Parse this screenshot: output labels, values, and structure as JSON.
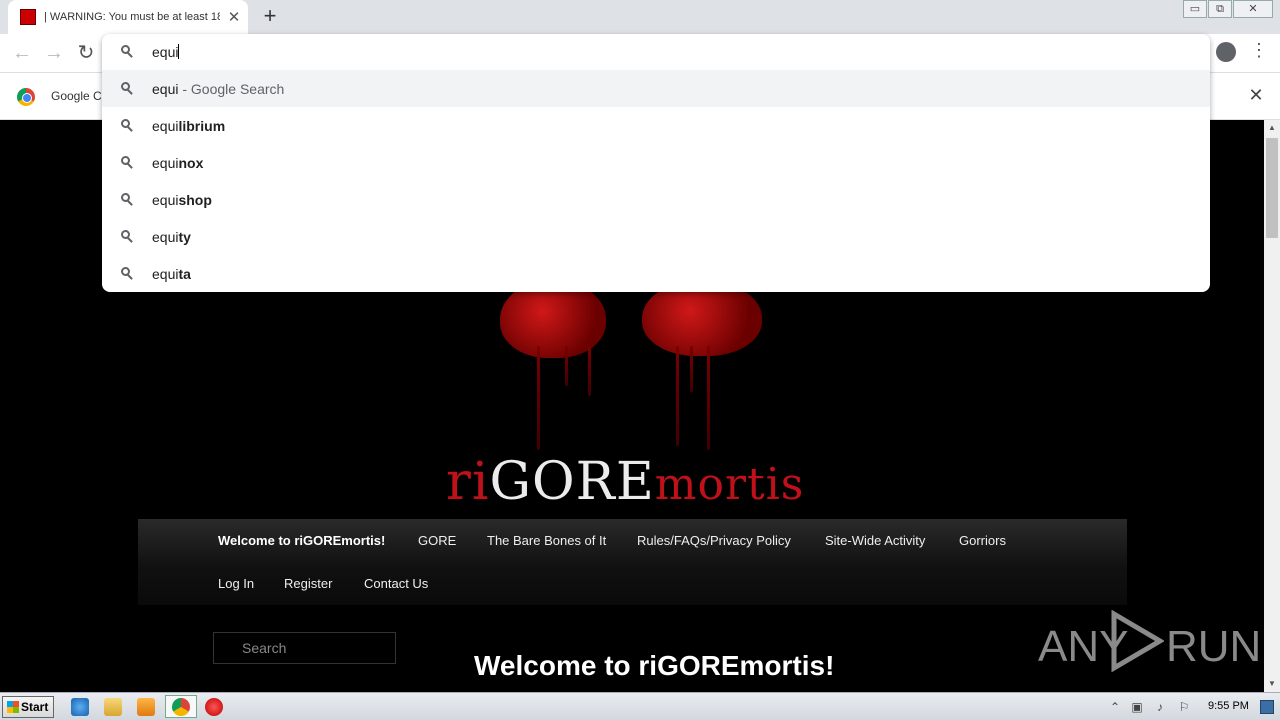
{
  "browser": {
    "tab_title": "| WARNING: You must be at least 18",
    "tab_close_glyph": "✕",
    "new_tab_glyph": "+",
    "window_buttons": [
      "▭",
      "⧉",
      "✕"
    ],
    "nav_glyphs": {
      "back": "←",
      "forward": "→",
      "reload": "↻"
    },
    "menu_glyph": "⋮"
  },
  "omnibox": {
    "value": "equi",
    "suggestions": [
      {
        "typed": "equi",
        "completion": "",
        "suffix": " - Google Search",
        "selected": true
      },
      {
        "typed": "equi",
        "completion": "librium",
        "suffix": "",
        "selected": false
      },
      {
        "typed": "equi",
        "completion": "nox",
        "suffix": "",
        "selected": false
      },
      {
        "typed": "equi",
        "completion": "shop",
        "suffix": "",
        "selected": false
      },
      {
        "typed": "equi",
        "completion": "ty",
        "suffix": "",
        "selected": false
      },
      {
        "typed": "equi",
        "completion": "ta",
        "suffix": "",
        "selected": false
      }
    ]
  },
  "infobar": {
    "text": "Google Cl",
    "close_glyph": "✕"
  },
  "site": {
    "logo": {
      "part1": "ri",
      "part2": "GORE",
      "part3": "mortis"
    },
    "nav_row1": [
      "Welcome to riGOREmortis!",
      "GORE",
      "The Bare Bones of It",
      "Rules/FAQs/Privacy Policy",
      "Site-Wide Activity",
      "Gorriors"
    ],
    "nav_row2": [
      "Log In",
      "Register",
      "Contact Us"
    ],
    "search_placeholder": "Search",
    "welcome_heading": "Welcome to riGOREmortis!"
  },
  "watermark": {
    "left": "ANY",
    "right": "RUN"
  },
  "taskbar": {
    "start_label": "Start",
    "clock": "9:55 PM"
  },
  "colors": {
    "blood_red": "#c0101a",
    "page_bg": "#000000",
    "suggestion_selected_bg": "#f1f3f4"
  }
}
